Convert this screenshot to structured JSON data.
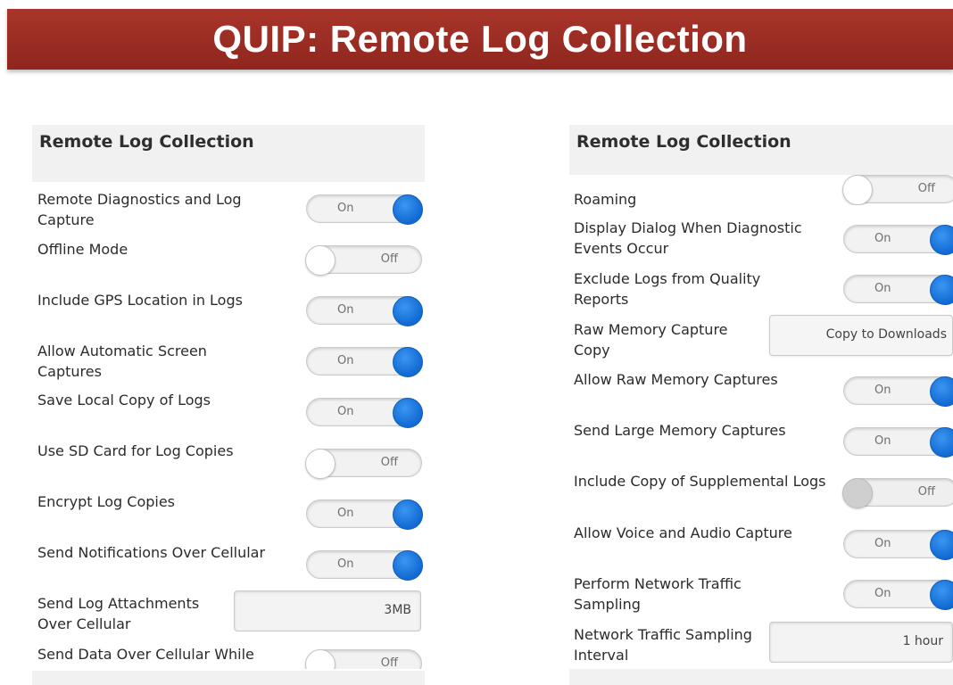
{
  "banner": {
    "title": "QUIP: Remote Log Collection"
  },
  "left_panel": {
    "heading": "Remote Log Collection",
    "rows": [
      {
        "label": "Remote Diagnostics and Log Capture",
        "toggle": "On"
      },
      {
        "label": "Offline Mode",
        "toggle": "Off"
      },
      {
        "label": "Include GPS Location in Logs",
        "toggle": "On"
      },
      {
        "label": "Allow Automatic Screen Captures",
        "toggle": "On"
      },
      {
        "label": "Save Local Copy of Logs",
        "toggle": "On"
      },
      {
        "label": "Use SD Card for Log Copies",
        "toggle": "Off"
      },
      {
        "label": "Encrypt Log Copies",
        "toggle": "On"
      },
      {
        "label": "Send Notifications Over Cellular",
        "toggle": "On"
      },
      {
        "label": "Send Log Attachments Over Cellular",
        "value": "3MB"
      },
      {
        "label": "Send Data Over Cellular While",
        "toggle": "Off"
      }
    ]
  },
  "right_panel": {
    "heading": "Remote Log Collection",
    "rows": [
      {
        "label": "Roaming",
        "toggle": "Off"
      },
      {
        "label": "Display Dialog When Diagnostic Events Occur",
        "toggle": "On"
      },
      {
        "label": "Exclude Logs from Quality Reports",
        "toggle": "On"
      },
      {
        "label": "Raw Memory Capture Copy",
        "value": "Copy to Downloads"
      },
      {
        "label": "Allow Raw Memory Captures",
        "toggle": "On"
      },
      {
        "label": "Send Large Memory Captures",
        "toggle": "On"
      },
      {
        "label": "Include Copy of Supplemental Logs",
        "toggle": "Off"
      },
      {
        "label": "Allow Voice and Audio Capture",
        "toggle": "On"
      },
      {
        "label": "Perform Network Traffic Sampling",
        "toggle": "On"
      },
      {
        "label": "Network Traffic Sampling Interval",
        "value": "1 hour"
      }
    ]
  },
  "colors": {
    "banner": "#9e2c23",
    "toggle_on_knob": "#1a73d9",
    "panel_header": "#f1f1f1"
  }
}
